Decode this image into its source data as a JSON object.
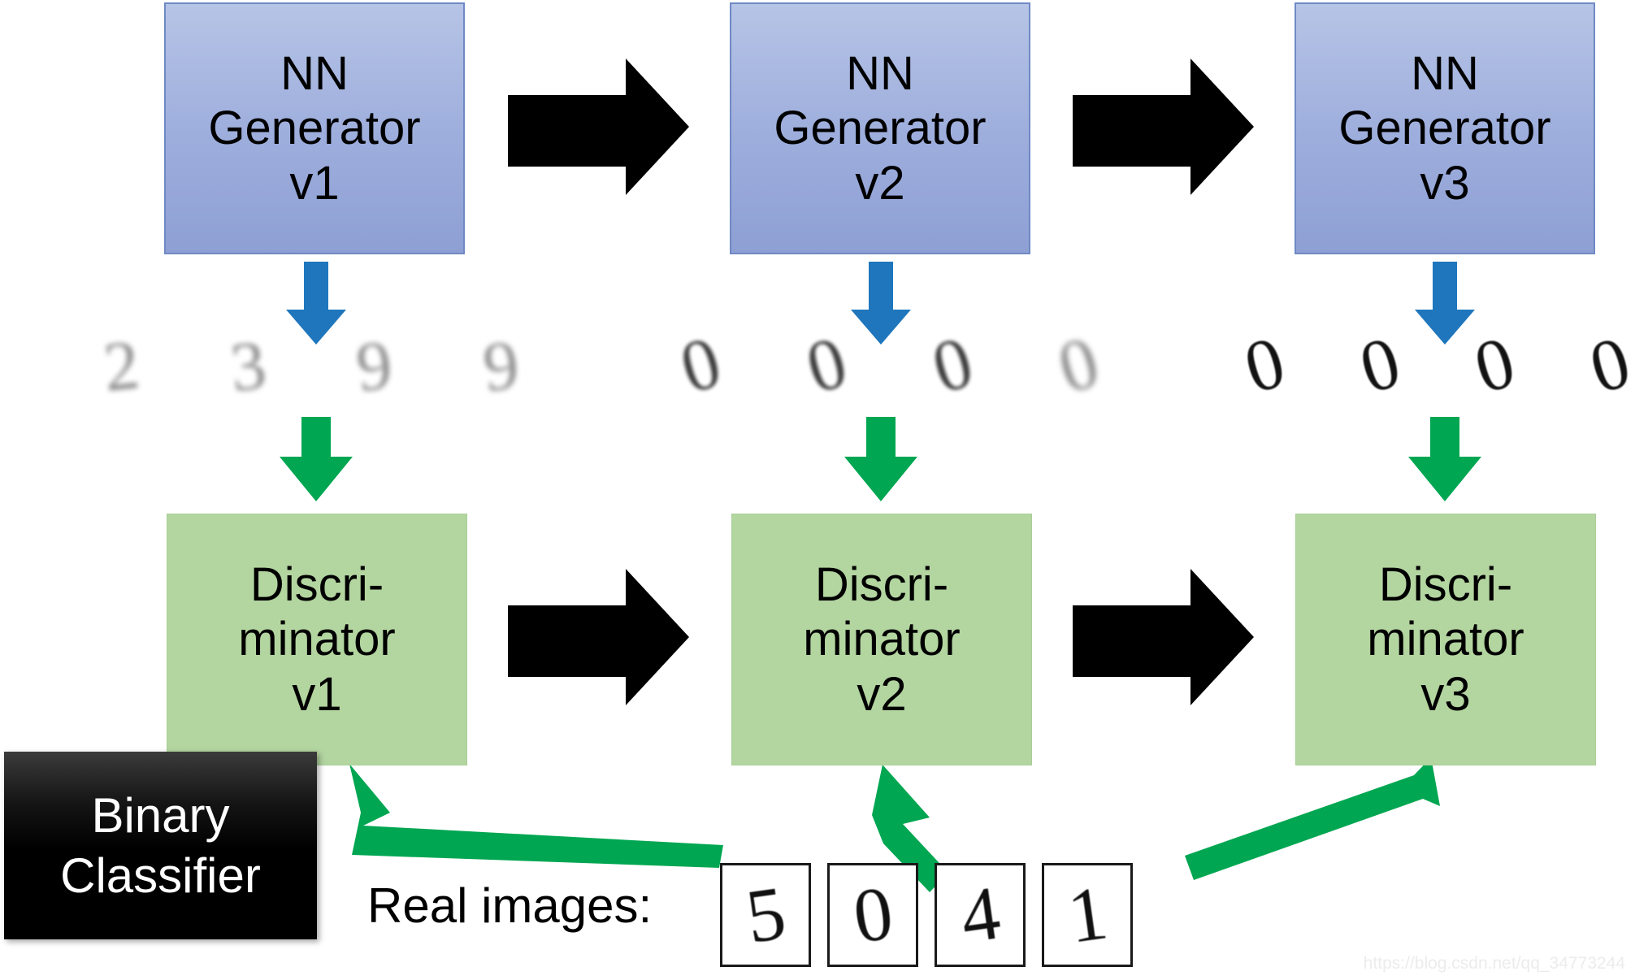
{
  "diagram": {
    "title": "GAN training iteration diagram",
    "colors": {
      "generator_fill": "#9daddc",
      "generator_border": "#6f89c4",
      "discriminator_fill": "#b3d5a0",
      "discriminator_border": "#a9cf97",
      "blue_arrow": "#1f76bc",
      "green_arrow": "#00a651",
      "black_arrow": "#000000",
      "plaque_bg": "#000000",
      "plaque_text": "#ffffff"
    }
  },
  "generators": [
    {
      "line1": "NN",
      "line2": "Generator",
      "line3": "v1"
    },
    {
      "line1": "NN",
      "line2": "Generator",
      "line3": "v2"
    },
    {
      "line1": "NN",
      "line2": "Generator",
      "line3": "v3"
    }
  ],
  "discriminators": [
    {
      "line1": "Discri-",
      "line2": "minator",
      "line3": "v1"
    },
    {
      "line1": "Discri-",
      "line2": "minator",
      "line3": "v2"
    },
    {
      "line1": "Discri-",
      "line2": "minator",
      "line3": "v3"
    }
  ],
  "generated_samples": [
    {
      "stage": "v1",
      "digits": [
        "2",
        "3",
        "9",
        "9"
      ],
      "quality": "very blurry"
    },
    {
      "stage": "v2",
      "digits": [
        "0",
        "0",
        "0",
        "0"
      ],
      "quality": "blurry"
    },
    {
      "stage": "v3",
      "digits": [
        "0",
        "0",
        "0",
        "0"
      ],
      "quality": "sharp"
    }
  ],
  "binary_classifier": {
    "line1": "Binary",
    "line2": "Classifier"
  },
  "real_images": {
    "label": "Real images:",
    "digits": [
      "5",
      "0",
      "4",
      "1"
    ]
  },
  "watermark": {
    "text": "https://blog.csdn.net/qq_34773244"
  }
}
